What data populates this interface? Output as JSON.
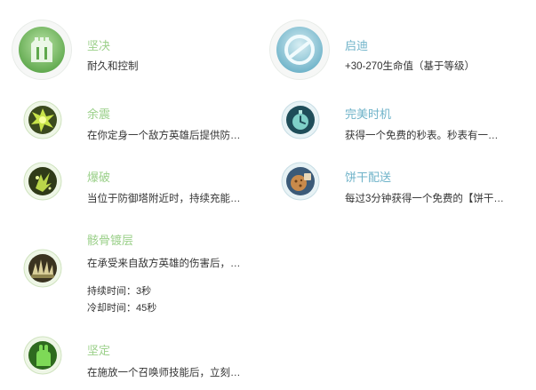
{
  "colors": {
    "keystone_green": "#9bd08a",
    "keystone_teal": "#6fb3c9",
    "text": "#333333"
  },
  "left": {
    "keystone": {
      "title": "坚决",
      "desc": "耐久和控制",
      "icon": "grasp-tower-icon"
    },
    "runes": [
      {
        "title": "余震",
        "desc": "在你定身一个敌方英雄后提供防…",
        "icon": "aftershock-icon"
      },
      {
        "title": "爆破",
        "desc": "当位于防御塔附近时，持续充能…",
        "icon": "demolish-icon"
      },
      {
        "title": "骸骨镀层",
        "desc": "在承受来自敌方英雄的伤害后，…",
        "icon": "bone-plating-icon",
        "meta": [
          "持续时间：3秒",
          "冷却时间：45秒"
        ]
      },
      {
        "title": "坚定",
        "desc": "在施放一个召唤师技能后，立刻…",
        "icon": "unflinching-icon"
      }
    ]
  },
  "right": {
    "keystone": {
      "title": "启迪",
      "desc": "+30-270生命值（基于等级）",
      "icon": "inspiration-icon"
    },
    "runes": [
      {
        "title": "完美时机",
        "desc": "获得一个免费的秒表。秒表有一…",
        "icon": "stopwatch-icon"
      },
      {
        "title": "饼干配送",
        "desc": "每过3分钟获得一个免费的【饼干…",
        "icon": "cookie-delivery-icon"
      }
    ]
  }
}
